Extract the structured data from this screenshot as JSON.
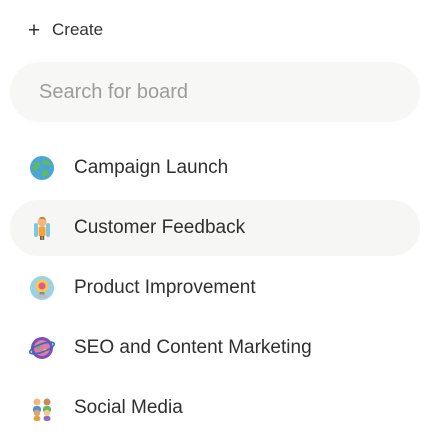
{
  "create": {
    "label": "Create"
  },
  "search": {
    "placeholder": "Search for board",
    "value": ""
  },
  "boards": [
    {
      "label": "Campaign Launch",
      "icon": "globe-icon"
    },
    {
      "label": "Customer Feedback",
      "icon": "person-icon"
    },
    {
      "label": "Product Improvement",
      "icon": "lightbulb-icon"
    },
    {
      "label": "SEO and Content Marketing",
      "icon": "planet-icon"
    },
    {
      "label": "Social Media",
      "icon": "people-icon"
    }
  ],
  "colors": {
    "hover_row": "#f6f6f5",
    "search_bg": "#f7f7f6",
    "text": "#2f2f2f",
    "placeholder": "#9c9c9c"
  }
}
